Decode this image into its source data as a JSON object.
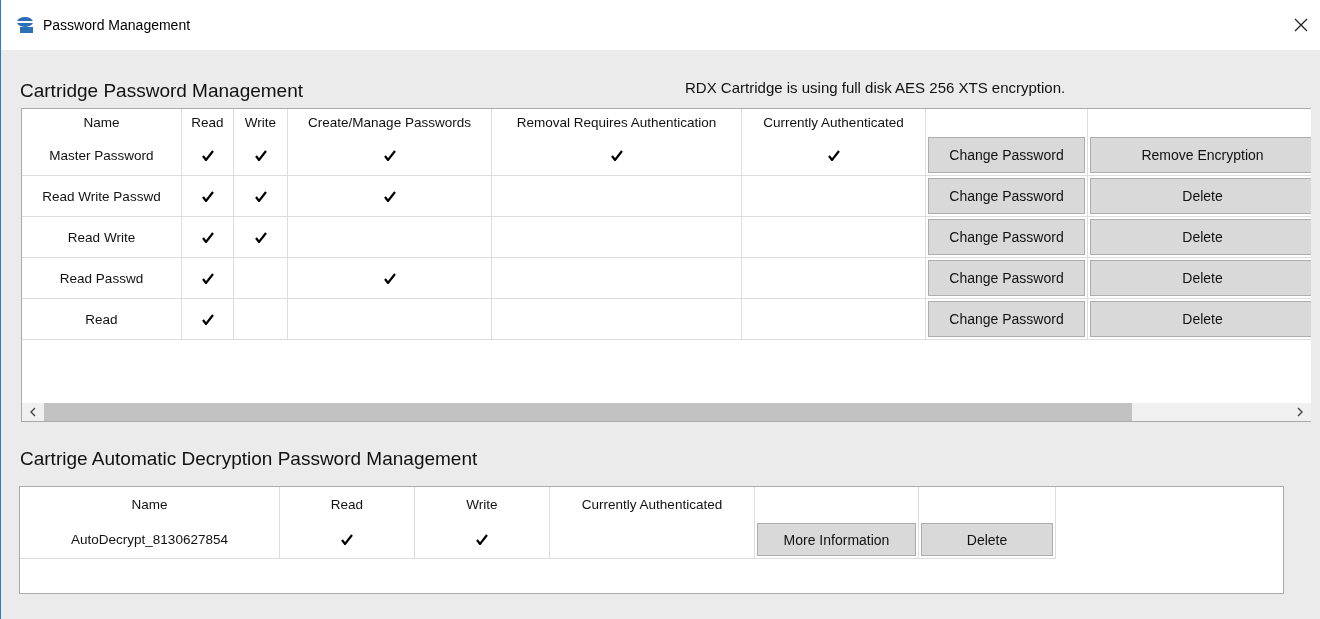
{
  "window": {
    "title": "Password Management"
  },
  "cartridge": {
    "title": "Cartridge Password Management",
    "note": "RDX Cartridge is using full disk AES 256 XTS encryption.",
    "columns": [
      "Name",
      "Read",
      "Write",
      "Create/Manage Passwords",
      "Removal Requires Authentication",
      "Currently Authenticated"
    ],
    "rows": [
      {
        "name": "Master Password",
        "read": true,
        "write": true,
        "manage": true,
        "removal": true,
        "authenticated": true,
        "buttons": [
          "Change Password",
          "Remove Encryption"
        ]
      },
      {
        "name": "Read Write Passwd",
        "read": true,
        "write": true,
        "manage": true,
        "removal": false,
        "authenticated": false,
        "buttons": [
          "Change Password",
          "Delete"
        ]
      },
      {
        "name": "Read Write",
        "read": true,
        "write": true,
        "manage": false,
        "removal": false,
        "authenticated": false,
        "buttons": [
          "Change Password",
          "Delete"
        ]
      },
      {
        "name": "Read Passwd",
        "read": true,
        "write": false,
        "manage": true,
        "removal": false,
        "authenticated": false,
        "buttons": [
          "Change Password",
          "Delete"
        ]
      },
      {
        "name": "Read",
        "read": true,
        "write": false,
        "manage": false,
        "removal": false,
        "authenticated": false,
        "buttons": [
          "Change Password",
          "Delete"
        ]
      }
    ]
  },
  "auto_decryption": {
    "title": "Cartrige Automatic Decryption Password Management",
    "columns": [
      "Name",
      "Read",
      "Write",
      "Currently Authenticated"
    ],
    "rows": [
      {
        "name": "AutoDecrypt_8130627854",
        "read": true,
        "write": true,
        "authenticated": false,
        "buttons": [
          "More Information",
          "Delete"
        ]
      }
    ]
  }
}
